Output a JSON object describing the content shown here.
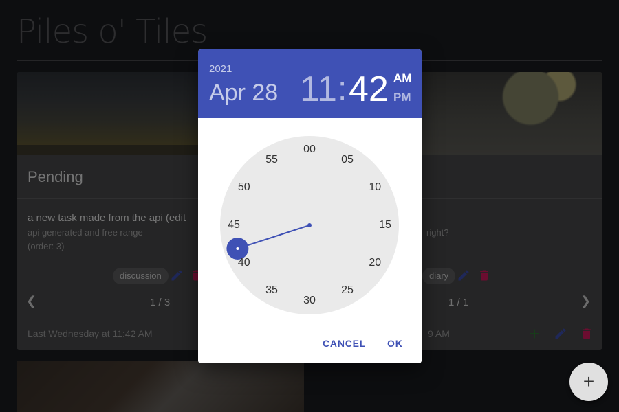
{
  "app": {
    "title": "Piles o' Tiles"
  },
  "cards": {
    "left": {
      "title": "Pending",
      "task_title": "a new task made from the api (edit",
      "task_sub": "api generated and free range",
      "task_order": "(order: 3)",
      "tag": "discussion",
      "pager": "1 / 3",
      "footer": "Last Wednesday at 11:42 AM"
    },
    "right": {
      "task_sub_partial": "right?",
      "tag": "diary",
      "pager": "1 / 1",
      "footer_partial": "9 AM"
    }
  },
  "fab": {
    "icon": "+"
  },
  "picker": {
    "year": "2021",
    "date": "Apr 28",
    "hour": "11",
    "colon": ":",
    "minute": "42",
    "am": "AM",
    "pm": "PM",
    "selected_minute": 42,
    "dial_labels": [
      "00",
      "05",
      "10",
      "15",
      "20",
      "25",
      "30",
      "35",
      "40",
      "45",
      "50",
      "55"
    ],
    "cancel_label": "CANCEL",
    "ok_label": "OK"
  },
  "colors": {
    "accent": "#3f51b5",
    "delete": "#d81b60",
    "add": "#2e7d32",
    "edit": "#3f51b5"
  }
}
